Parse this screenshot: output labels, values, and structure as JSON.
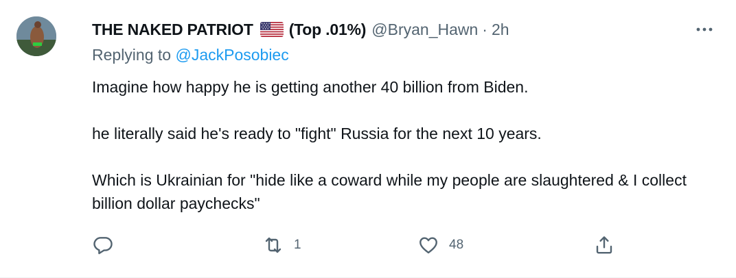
{
  "author": {
    "display_name": "THE NAKED PATRIOT",
    "flag_icon": "us-flag-icon",
    "badge": "(Top .01%)",
    "handle": "@Bryan_Hawn",
    "separator": "·",
    "time": "2h"
  },
  "reply": {
    "prefix": "Replying to",
    "mention": "@JackPosobiec"
  },
  "text": {
    "p1": "Imagine how happy he is getting another 40 billion from Biden.",
    "p2": "he literally said he's ready to \"fight\" Russia for the next 10 years.",
    "p3": "Which is Ukrainian for \"hide like a coward while my people are slaughtered & I collect billion dollar paychecks\""
  },
  "actions": {
    "reply_icon": "reply-icon",
    "retweet_icon": "retweet-icon",
    "retweet_count": "1",
    "like_icon": "heart-icon",
    "like_count": "48",
    "share_icon": "share-icon"
  },
  "colors": {
    "text": "#0f1419",
    "secondary": "#536471",
    "link": "#1d9bf0",
    "divider": "#eff3f4"
  }
}
